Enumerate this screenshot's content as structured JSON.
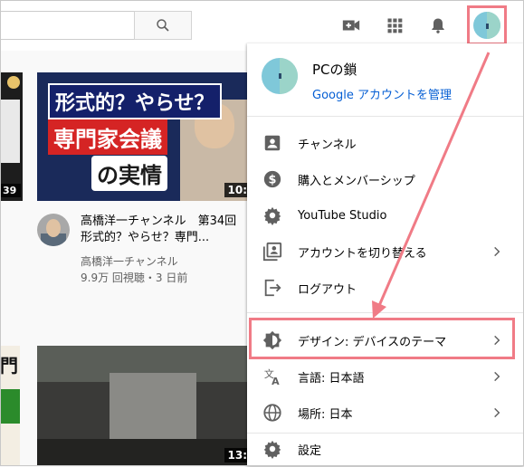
{
  "header": {
    "search_placeholder": "",
    "icons": [
      "search-icon",
      "create-video-icon",
      "apps-grid-icon",
      "notifications-bell-icon"
    ]
  },
  "videos": [
    {
      "thumb_text": [
        "形式的？やらせ？",
        "専門家会議",
        "の実情"
      ],
      "duration": "10:",
      "title": "高橋洋一チャンネル　第34回　形式的？やらせ？専門...",
      "channel": "高橋洋一チャンネル",
      "meta": "9.9万 回視聴・3 日前"
    },
    {
      "thumb_text": [],
      "duration": "13:"
    }
  ],
  "left_partial": {
    "duration": "39",
    "text": "門"
  },
  "account_menu": {
    "account_name": "PCの鎖",
    "manage_link": "Google アカウントを管理",
    "items": [
      {
        "label": "チャンネル",
        "icon": "channel-icon",
        "chevron": false
      },
      {
        "label": "購入とメンバーシップ",
        "icon": "dollar-icon",
        "chevron": false
      },
      {
        "label": "YouTube Studio",
        "icon": "gear-icon",
        "chevron": false
      },
      {
        "label": "アカウントを切り替える",
        "icon": "switch-account-icon",
        "chevron": true
      },
      {
        "label": "ログアウト",
        "icon": "logout-icon",
        "chevron": false
      },
      {
        "label": "デザイン: デバイスのテーマ",
        "icon": "theme-icon",
        "chevron": true
      },
      {
        "label": "言語: 日本語",
        "icon": "translate-icon",
        "chevron": true
      },
      {
        "label": "場所: 日本",
        "icon": "globe-icon",
        "chevron": true
      },
      {
        "label": "設定",
        "icon": "settings-icon",
        "chevron": false
      }
    ]
  },
  "colors": {
    "highlight": "#f07b86",
    "link": "#065fd4"
  }
}
